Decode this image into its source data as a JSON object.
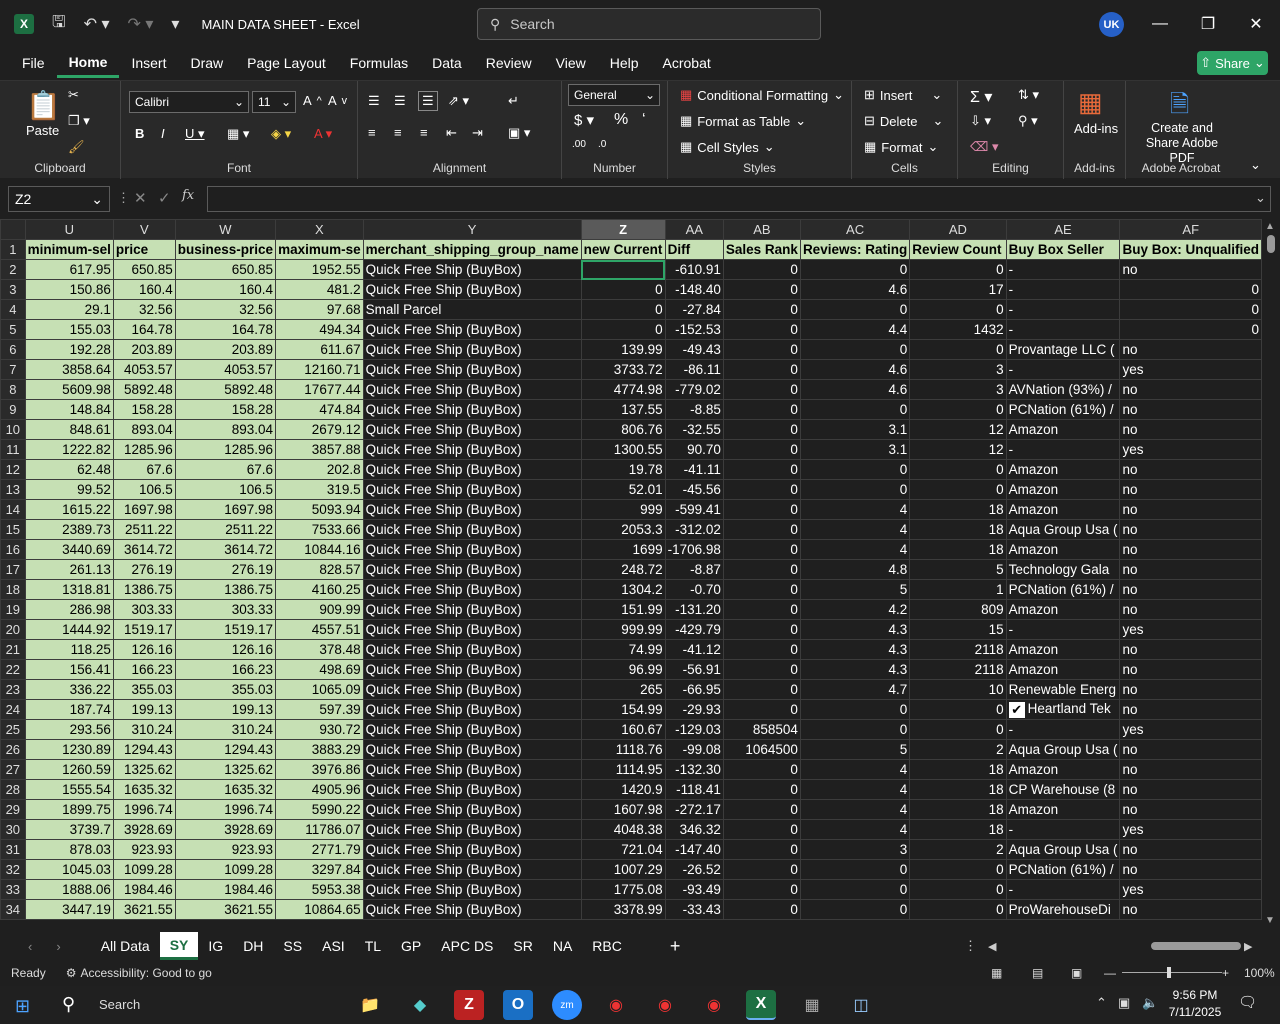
{
  "title": {
    "doc": "MAIN DATA SHEET  -  Excel",
    "search_placeholder": "Search",
    "avatar": "UK"
  },
  "menu": [
    "File",
    "Home",
    "Insert",
    "Draw",
    "Page Layout",
    "Formulas",
    "Data",
    "Review",
    "View",
    "Help",
    "Acrobat"
  ],
  "share_label": "Share",
  "ribbon": {
    "paste": "Paste",
    "clipboard": "Clipboard",
    "font_name": "Calibri",
    "font_size": "11",
    "font": "Font",
    "alignment": "Alignment",
    "number_format": "General",
    "number": "Number",
    "conditional": "Conditional Formatting",
    "format_table": "Format as Table",
    "cell_styles": "Cell Styles",
    "styles": "Styles",
    "insert": "Insert",
    "delete": "Delete",
    "format": "Format",
    "cells": "Cells",
    "editing": "Editing",
    "addins": "Add-ins",
    "addins_group": "Add-ins",
    "create_share": "Create and Share Adobe PDF",
    "acrobat_group": "Adobe Acrobat"
  },
  "namebox": "Z2",
  "fx": "fx",
  "columns": [
    "U",
    "V",
    "W",
    "X",
    "Y",
    "Z",
    "AA",
    "AB",
    "AC",
    "AD",
    "AE",
    "AF"
  ],
  "headers": [
    "minimum-sel",
    "price",
    "business-price",
    "maximum-se",
    "merchant_shipping_group_name",
    "new Current",
    "Diff",
    "Sales Rank",
    "Reviews: Rating",
    "Review Count",
    "Buy Box Seller",
    "Buy Box: Unqualified"
  ],
  "rows": [
    [
      "617.95",
      "650.85",
      "650.85",
      "1952.55",
      "Quick Free Ship (BuyBox)",
      "",
      "-610.91",
      "0",
      "0",
      "0",
      "-",
      "no"
    ],
    [
      "150.86",
      "160.4",
      "160.4",
      "481.2",
      "Quick Free Ship (BuyBox)",
      "0",
      "-148.40",
      "0",
      "4.6",
      "17",
      "-",
      "0"
    ],
    [
      "29.1",
      "32.56",
      "32.56",
      "97.68",
      "Small Parcel",
      "0",
      "-27.84",
      "0",
      "0",
      "0",
      "-",
      "0"
    ],
    [
      "155.03",
      "164.78",
      "164.78",
      "494.34",
      "Quick Free Ship (BuyBox)",
      "0",
      "-152.53",
      "0",
      "4.4",
      "1432",
      "-",
      "0"
    ],
    [
      "192.28",
      "203.89",
      "203.89",
      "611.67",
      "Quick Free Ship (BuyBox)",
      "139.99",
      "-49.43",
      "0",
      "0",
      "0",
      "Provantage LLC (",
      "no"
    ],
    [
      "3858.64",
      "4053.57",
      "4053.57",
      "12160.71",
      "Quick Free Ship (BuyBox)",
      "3733.72",
      "-86.11",
      "0",
      "4.6",
      "3",
      "-",
      "yes"
    ],
    [
      "5609.98",
      "5892.48",
      "5892.48",
      "17677.44",
      "Quick Free Ship (BuyBox)",
      "4774.98",
      "-779.02",
      "0",
      "4.6",
      "3",
      "AVNation (93%) /",
      "no"
    ],
    [
      "148.84",
      "158.28",
      "158.28",
      "474.84",
      "Quick Free Ship (BuyBox)",
      "137.55",
      "-8.85",
      "0",
      "0",
      "0",
      "PCNation (61%) /",
      "no"
    ],
    [
      "848.61",
      "893.04",
      "893.04",
      "2679.12",
      "Quick Free Ship (BuyBox)",
      "806.76",
      "-32.55",
      "0",
      "3.1",
      "12",
      "Amazon",
      "no"
    ],
    [
      "1222.82",
      "1285.96",
      "1285.96",
      "3857.88",
      "Quick Free Ship (BuyBox)",
      "1300.55",
      "90.70",
      "0",
      "3.1",
      "12",
      "-",
      "yes"
    ],
    [
      "62.48",
      "67.6",
      "67.6",
      "202.8",
      "Quick Free Ship (BuyBox)",
      "19.78",
      "-41.11",
      "0",
      "0",
      "0",
      "Amazon",
      "no"
    ],
    [
      "99.52",
      "106.5",
      "106.5",
      "319.5",
      "Quick Free Ship (BuyBox)",
      "52.01",
      "-45.56",
      "0",
      "0",
      "0",
      "Amazon",
      "no"
    ],
    [
      "1615.22",
      "1697.98",
      "1697.98",
      "5093.94",
      "Quick Free Ship (BuyBox)",
      "999",
      "-599.41",
      "0",
      "4",
      "18",
      "Amazon",
      "no"
    ],
    [
      "2389.73",
      "2511.22",
      "2511.22",
      "7533.66",
      "Quick Free Ship (BuyBox)",
      "2053.3",
      "-312.02",
      "0",
      "4",
      "18",
      "Aqua Group Usa (",
      "no"
    ],
    [
      "3440.69",
      "3614.72",
      "3614.72",
      "10844.16",
      "Quick Free Ship (BuyBox)",
      "1699",
      "-1706.98",
      "0",
      "4",
      "18",
      "Amazon",
      "no"
    ],
    [
      "261.13",
      "276.19",
      "276.19",
      "828.57",
      "Quick Free Ship (BuyBox)",
      "248.72",
      "-8.87",
      "0",
      "4.8",
      "5",
      "Technology Gala",
      "no"
    ],
    [
      "1318.81",
      "1386.75",
      "1386.75",
      "4160.25",
      "Quick Free Ship (BuyBox)",
      "1304.2",
      "-0.70",
      "0",
      "5",
      "1",
      "PCNation (61%) /",
      "no"
    ],
    [
      "286.98",
      "303.33",
      "303.33",
      "909.99",
      "Quick Free Ship (BuyBox)",
      "151.99",
      "-131.20",
      "0",
      "4.2",
      "809",
      "Amazon",
      "no"
    ],
    [
      "1444.92",
      "1519.17",
      "1519.17",
      "4557.51",
      "Quick Free Ship (BuyBox)",
      "999.99",
      "-429.79",
      "0",
      "4.3",
      "15",
      "-",
      "yes"
    ],
    [
      "118.25",
      "126.16",
      "126.16",
      "378.48",
      "Quick Free Ship (BuyBox)",
      "74.99",
      "-41.12",
      "0",
      "4.3",
      "2118",
      "Amazon",
      "no"
    ],
    [
      "156.41",
      "166.23",
      "166.23",
      "498.69",
      "Quick Free Ship (BuyBox)",
      "96.99",
      "-56.91",
      "0",
      "4.3",
      "2118",
      "Amazon",
      "no"
    ],
    [
      "336.22",
      "355.03",
      "355.03",
      "1065.09",
      "Quick Free Ship (BuyBox)",
      "265",
      "-66.95",
      "0",
      "4.7",
      "10",
      "Renewable Energ",
      "no"
    ],
    [
      "187.74",
      "199.13",
      "199.13",
      "597.39",
      "Quick Free Ship (BuyBox)",
      "154.99",
      "-29.93",
      "0",
      "0",
      "0",
      "Heartland Tek",
      "no"
    ],
    [
      "293.56",
      "310.24",
      "310.24",
      "930.72",
      "Quick Free Ship (BuyBox)",
      "160.67",
      "-129.03",
      "858504",
      "0",
      "0",
      "-",
      "yes"
    ],
    [
      "1230.89",
      "1294.43",
      "1294.43",
      "3883.29",
      "Quick Free Ship (BuyBox)",
      "1118.76",
      "-99.08",
      "1064500",
      "5",
      "2",
      "Aqua Group Usa (",
      "no"
    ],
    [
      "1260.59",
      "1325.62",
      "1325.62",
      "3976.86",
      "Quick Free Ship (BuyBox)",
      "1114.95",
      "-132.30",
      "0",
      "4",
      "18",
      "Amazon",
      "no"
    ],
    [
      "1555.54",
      "1635.32",
      "1635.32",
      "4905.96",
      "Quick Free Ship (BuyBox)",
      "1420.9",
      "-118.41",
      "0",
      "4",
      "18",
      "CP Warehouse (8",
      "no"
    ],
    [
      "1899.75",
      "1996.74",
      "1996.74",
      "5990.22",
      "Quick Free Ship (BuyBox)",
      "1607.98",
      "-272.17",
      "0",
      "4",
      "18",
      "Amazon",
      "no"
    ],
    [
      "3739.7",
      "3928.69",
      "3928.69",
      "11786.07",
      "Quick Free Ship (BuyBox)",
      "4048.38",
      "346.32",
      "0",
      "4",
      "18",
      "-",
      "yes"
    ],
    [
      "878.03",
      "923.93",
      "923.93",
      "2771.79",
      "Quick Free Ship (BuyBox)",
      "721.04",
      "-147.40",
      "0",
      "3",
      "2",
      "Aqua Group Usa (",
      "no"
    ],
    [
      "1045.03",
      "1099.28",
      "1099.28",
      "3297.84",
      "Quick Free Ship (BuyBox)",
      "1007.29",
      "-26.52",
      "0",
      "0",
      "0",
      "PCNation (61%) /",
      "no"
    ],
    [
      "1888.06",
      "1984.46",
      "1984.46",
      "5953.38",
      "Quick Free Ship (BuyBox)",
      "1775.08",
      "-93.49",
      "0",
      "0",
      "0",
      "-",
      "yes"
    ],
    [
      "3447.19",
      "3621.55",
      "3621.55",
      "10864.65",
      "Quick Free Ship (BuyBox)",
      "3378.99",
      "-33.43",
      "0",
      "0",
      "0",
      "ProWarehouseDi",
      "no"
    ]
  ],
  "sheets": [
    "All Data",
    "SY",
    "IG",
    "DH",
    "SS",
    "ASI",
    "TL",
    "GP",
    "APC DS",
    "SR",
    "NA",
    "RBC"
  ],
  "active_sheet": "SY",
  "status": {
    "ready": "Ready",
    "accessibility": "Accessibility: Good to go",
    "zoom": "100%"
  },
  "taskbar": {
    "search": "Search",
    "time": "9:56 PM",
    "date": "7/11/2025"
  }
}
